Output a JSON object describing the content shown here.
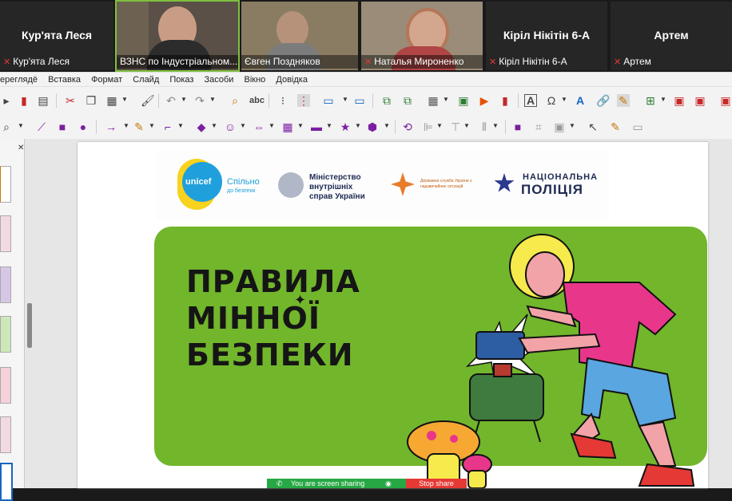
{
  "participants": [
    {
      "name": "Кур'ята Леся",
      "display": "Кур'ята Леся",
      "video": false,
      "muted": true
    },
    {
      "name": "ВЗНС по Індустріальном...",
      "video": true,
      "muted": false,
      "active": true
    },
    {
      "name": "Євген Поздняков",
      "video": true,
      "muted": false
    },
    {
      "name": "Наталья Мироненко",
      "video": true,
      "muted": true
    },
    {
      "name": "Кіріл Нікітін 6-А",
      "display": "Кіріл Нікітін 6-А",
      "video": false,
      "muted": true
    },
    {
      "name": "Артем",
      "display": "Артем",
      "video": false,
      "muted": true
    }
  ],
  "menu": [
    "Переглянути",
    "Вставка",
    "Формат",
    "Слайд",
    "Показ",
    "Засоби",
    "Вікно",
    "Довідка"
  ],
  "menu_visible": [
    "ереглядё",
    "Вставка",
    "Формат",
    "Слайд",
    "Показ",
    "Засоби",
    "Вікно",
    "Довідка"
  ],
  "slide": {
    "logos": {
      "unicef": "unicef",
      "unicef_sub": "Спільно",
      "unicef_sub2": "до безпеки",
      "mvs": "Міністерство внутрішніх справ України",
      "dsns": "Державна служба України з надзвичайних ситуацій",
      "police_1": "НАЦІОНАЛЬНА",
      "police_2": "ПОЛІЦІЯ"
    },
    "title_lines": [
      "ПРАВИЛА",
      "МІННОЇ",
      "БЕЗПЕКИ"
    ]
  },
  "share_bar": {
    "message": "You are screen sharing",
    "stop": "Stop share"
  },
  "colors": {
    "accent_green": "#72b62c",
    "share_green": "#27a844",
    "stop_red": "#e53935"
  }
}
